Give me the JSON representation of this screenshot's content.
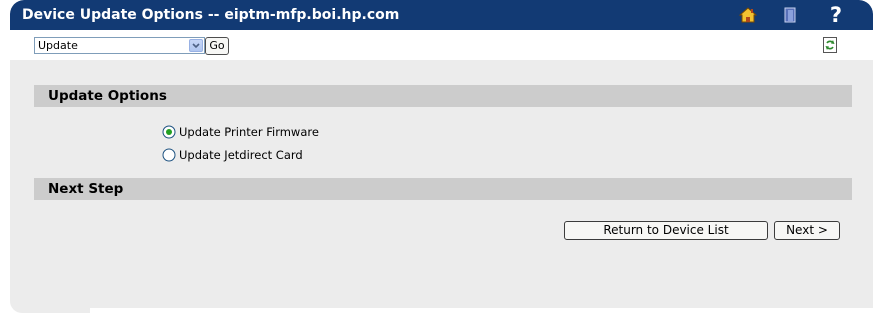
{
  "window": {
    "title": "Device Update Options -- eiptm-mfp.boi.hp.com"
  },
  "titlebar_icons": {
    "home": "home-icon",
    "exit": "door-icon",
    "help_glyph": "?"
  },
  "toolbar": {
    "select_value": "Update",
    "go_label": "Go",
    "refresh_icon": "refresh-icon"
  },
  "update_options": {
    "title": "Update Options",
    "options": [
      {
        "label": "Update Printer Firmware",
        "selected": true
      },
      {
        "label": "Update Jetdirect Card",
        "selected": false
      }
    ]
  },
  "next_step": {
    "title": "Next Step",
    "return_label": "Return to Device List",
    "next_label": "Next >"
  },
  "colors": {
    "titlebar": "#123a74",
    "panel": "#ececec",
    "section_header": "#cccccc"
  }
}
